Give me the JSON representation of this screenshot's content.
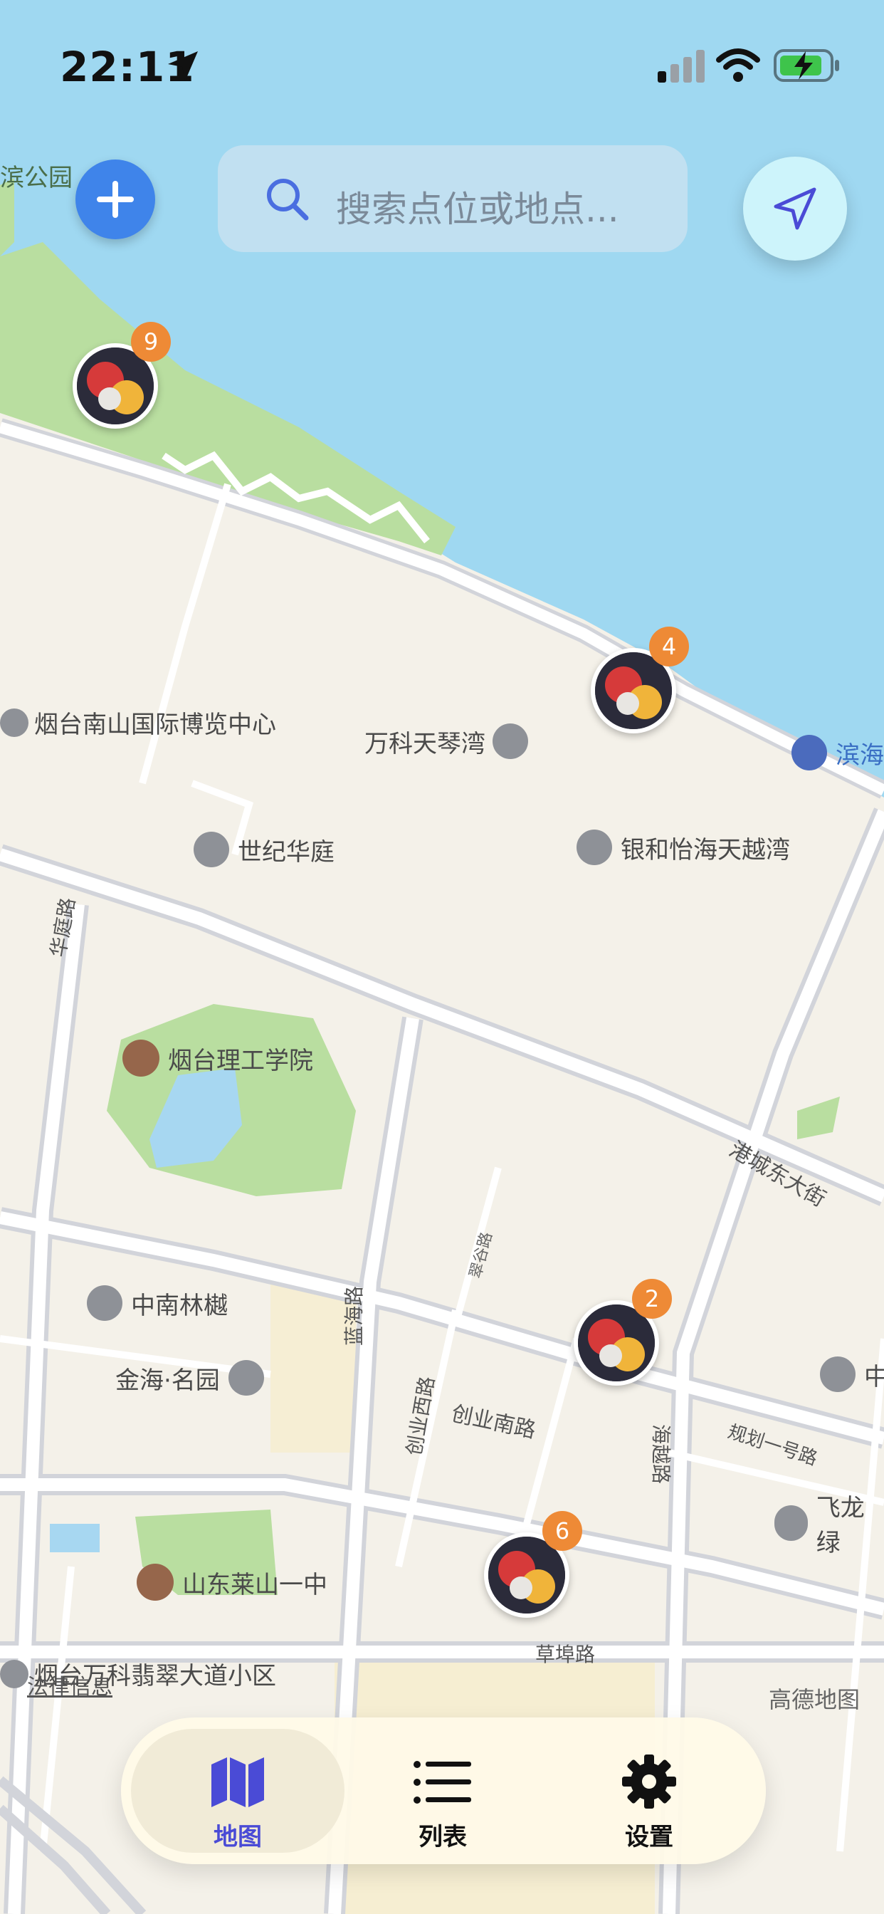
{
  "status_bar": {
    "time": "22:11"
  },
  "search": {
    "placeholder": "搜索点位或地点..."
  },
  "map": {
    "labels": [
      "烟台南山国际博览中心",
      "万科天琴湾",
      "世纪华庭",
      "银和怡海天越湾",
      "烟台理工学院",
      "中南林樾",
      "金海·名园",
      "山东莱山一中",
      "烟台万科翡翠大道小区",
      "飞龙绿",
      "中",
      "滨海"
    ],
    "partial_labels": {
      "park": "滨公园"
    },
    "roads": [
      "华庭路",
      "港城东大街",
      "蓝海路",
      "创业西路",
      "创业南路",
      "海越路",
      "规划一号路",
      "草埠路",
      "翠谷路"
    ],
    "attribution": "高德地图",
    "legal": "法律信息"
  },
  "pins": [
    {
      "count": "9"
    },
    {
      "count": "4"
    },
    {
      "count": "2"
    },
    {
      "count": "6"
    }
  ],
  "tabbar": {
    "tabs": [
      {
        "label": "地图",
        "icon": "map-icon",
        "active": true
      },
      {
        "label": "列表",
        "icon": "list-icon",
        "active": false
      },
      {
        "label": "设置",
        "icon": "gear-icon",
        "active": false
      }
    ]
  },
  "colors": {
    "water": "#9fd8f1",
    "land": "#f4f1e9",
    "park": "#b9dea0",
    "accent": "#4a4bd6",
    "badge": "#ee8a36",
    "add_button": "#3f84ea"
  }
}
